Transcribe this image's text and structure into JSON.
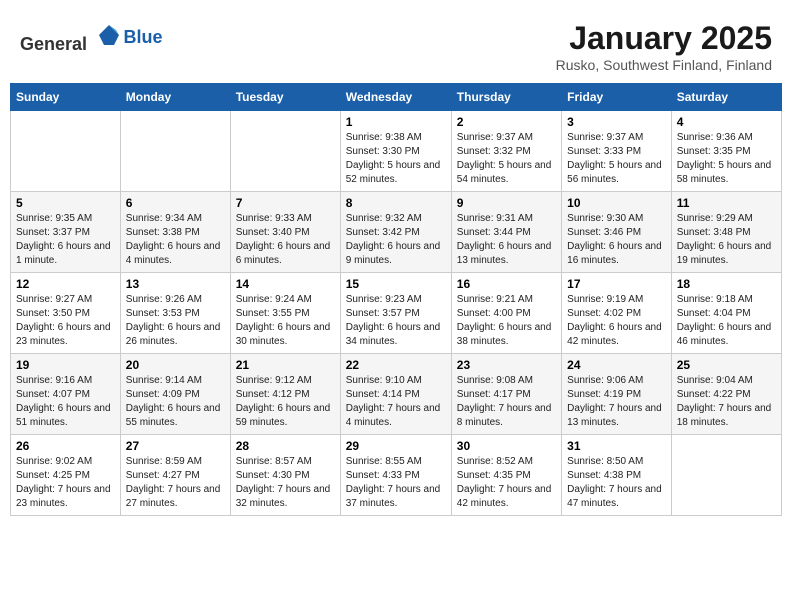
{
  "header": {
    "logo_general": "General",
    "logo_blue": "Blue",
    "title": "January 2025",
    "subtitle": "Rusko, Southwest Finland, Finland"
  },
  "days_of_week": [
    "Sunday",
    "Monday",
    "Tuesday",
    "Wednesday",
    "Thursday",
    "Friday",
    "Saturday"
  ],
  "weeks": [
    [
      {
        "day": "",
        "sunrise": "",
        "sunset": "",
        "daylight": ""
      },
      {
        "day": "",
        "sunrise": "",
        "sunset": "",
        "daylight": ""
      },
      {
        "day": "",
        "sunrise": "",
        "sunset": "",
        "daylight": ""
      },
      {
        "day": "1",
        "sunrise": "Sunrise: 9:38 AM",
        "sunset": "Sunset: 3:30 PM",
        "daylight": "Daylight: 5 hours and 52 minutes."
      },
      {
        "day": "2",
        "sunrise": "Sunrise: 9:37 AM",
        "sunset": "Sunset: 3:32 PM",
        "daylight": "Daylight: 5 hours and 54 minutes."
      },
      {
        "day": "3",
        "sunrise": "Sunrise: 9:37 AM",
        "sunset": "Sunset: 3:33 PM",
        "daylight": "Daylight: 5 hours and 56 minutes."
      },
      {
        "day": "4",
        "sunrise": "Sunrise: 9:36 AM",
        "sunset": "Sunset: 3:35 PM",
        "daylight": "Daylight: 5 hours and 58 minutes."
      }
    ],
    [
      {
        "day": "5",
        "sunrise": "Sunrise: 9:35 AM",
        "sunset": "Sunset: 3:37 PM",
        "daylight": "Daylight: 6 hours and 1 minute."
      },
      {
        "day": "6",
        "sunrise": "Sunrise: 9:34 AM",
        "sunset": "Sunset: 3:38 PM",
        "daylight": "Daylight: 6 hours and 4 minutes."
      },
      {
        "day": "7",
        "sunrise": "Sunrise: 9:33 AM",
        "sunset": "Sunset: 3:40 PM",
        "daylight": "Daylight: 6 hours and 6 minutes."
      },
      {
        "day": "8",
        "sunrise": "Sunrise: 9:32 AM",
        "sunset": "Sunset: 3:42 PM",
        "daylight": "Daylight: 6 hours and 9 minutes."
      },
      {
        "day": "9",
        "sunrise": "Sunrise: 9:31 AM",
        "sunset": "Sunset: 3:44 PM",
        "daylight": "Daylight: 6 hours and 13 minutes."
      },
      {
        "day": "10",
        "sunrise": "Sunrise: 9:30 AM",
        "sunset": "Sunset: 3:46 PM",
        "daylight": "Daylight: 6 hours and 16 minutes."
      },
      {
        "day": "11",
        "sunrise": "Sunrise: 9:29 AM",
        "sunset": "Sunset: 3:48 PM",
        "daylight": "Daylight: 6 hours and 19 minutes."
      }
    ],
    [
      {
        "day": "12",
        "sunrise": "Sunrise: 9:27 AM",
        "sunset": "Sunset: 3:50 PM",
        "daylight": "Daylight: 6 hours and 23 minutes."
      },
      {
        "day": "13",
        "sunrise": "Sunrise: 9:26 AM",
        "sunset": "Sunset: 3:53 PM",
        "daylight": "Daylight: 6 hours and 26 minutes."
      },
      {
        "day": "14",
        "sunrise": "Sunrise: 9:24 AM",
        "sunset": "Sunset: 3:55 PM",
        "daylight": "Daylight: 6 hours and 30 minutes."
      },
      {
        "day": "15",
        "sunrise": "Sunrise: 9:23 AM",
        "sunset": "Sunset: 3:57 PM",
        "daylight": "Daylight: 6 hours and 34 minutes."
      },
      {
        "day": "16",
        "sunrise": "Sunrise: 9:21 AM",
        "sunset": "Sunset: 4:00 PM",
        "daylight": "Daylight: 6 hours and 38 minutes."
      },
      {
        "day": "17",
        "sunrise": "Sunrise: 9:19 AM",
        "sunset": "Sunset: 4:02 PM",
        "daylight": "Daylight: 6 hours and 42 minutes."
      },
      {
        "day": "18",
        "sunrise": "Sunrise: 9:18 AM",
        "sunset": "Sunset: 4:04 PM",
        "daylight": "Daylight: 6 hours and 46 minutes."
      }
    ],
    [
      {
        "day": "19",
        "sunrise": "Sunrise: 9:16 AM",
        "sunset": "Sunset: 4:07 PM",
        "daylight": "Daylight: 6 hours and 51 minutes."
      },
      {
        "day": "20",
        "sunrise": "Sunrise: 9:14 AM",
        "sunset": "Sunset: 4:09 PM",
        "daylight": "Daylight: 6 hours and 55 minutes."
      },
      {
        "day": "21",
        "sunrise": "Sunrise: 9:12 AM",
        "sunset": "Sunset: 4:12 PM",
        "daylight": "Daylight: 6 hours and 59 minutes."
      },
      {
        "day": "22",
        "sunrise": "Sunrise: 9:10 AM",
        "sunset": "Sunset: 4:14 PM",
        "daylight": "Daylight: 7 hours and 4 minutes."
      },
      {
        "day": "23",
        "sunrise": "Sunrise: 9:08 AM",
        "sunset": "Sunset: 4:17 PM",
        "daylight": "Daylight: 7 hours and 8 minutes."
      },
      {
        "day": "24",
        "sunrise": "Sunrise: 9:06 AM",
        "sunset": "Sunset: 4:19 PM",
        "daylight": "Daylight: 7 hours and 13 minutes."
      },
      {
        "day": "25",
        "sunrise": "Sunrise: 9:04 AM",
        "sunset": "Sunset: 4:22 PM",
        "daylight": "Daylight: 7 hours and 18 minutes."
      }
    ],
    [
      {
        "day": "26",
        "sunrise": "Sunrise: 9:02 AM",
        "sunset": "Sunset: 4:25 PM",
        "daylight": "Daylight: 7 hours and 23 minutes."
      },
      {
        "day": "27",
        "sunrise": "Sunrise: 8:59 AM",
        "sunset": "Sunset: 4:27 PM",
        "daylight": "Daylight: 7 hours and 27 minutes."
      },
      {
        "day": "28",
        "sunrise": "Sunrise: 8:57 AM",
        "sunset": "Sunset: 4:30 PM",
        "daylight": "Daylight: 7 hours and 32 minutes."
      },
      {
        "day": "29",
        "sunrise": "Sunrise: 8:55 AM",
        "sunset": "Sunset: 4:33 PM",
        "daylight": "Daylight: 7 hours and 37 minutes."
      },
      {
        "day": "30",
        "sunrise": "Sunrise: 8:52 AM",
        "sunset": "Sunset: 4:35 PM",
        "daylight": "Daylight: 7 hours and 42 minutes."
      },
      {
        "day": "31",
        "sunrise": "Sunrise: 8:50 AM",
        "sunset": "Sunset: 4:38 PM",
        "daylight": "Daylight: 7 hours and 47 minutes."
      },
      {
        "day": "",
        "sunrise": "",
        "sunset": "",
        "daylight": ""
      }
    ]
  ]
}
